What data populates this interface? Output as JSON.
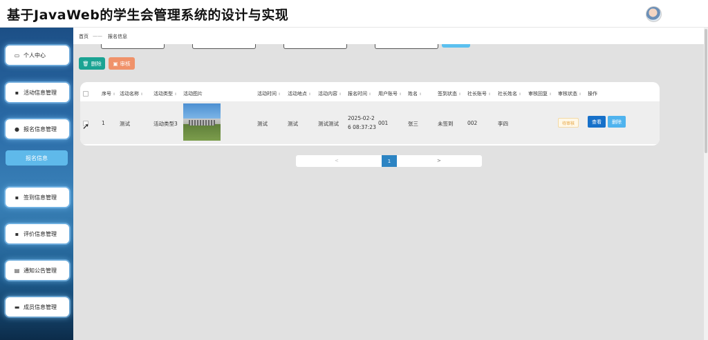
{
  "app": {
    "title": "基于JavaWeb的学生会管理系统的设计与实现"
  },
  "sidebar": {
    "items": [
      {
        "label": "个人中心",
        "icon": "calendar-icon"
      },
      {
        "label": "活动信息管理",
        "icon": "grid-icon"
      },
      {
        "label": "报名信息管理",
        "icon": "user-icon"
      },
      {
        "label": "签到信息管理",
        "icon": "grid-icon"
      },
      {
        "label": "评价信息管理",
        "icon": "grid-icon"
      },
      {
        "label": "通知公告管理",
        "icon": "clipboard-icon"
      },
      {
        "label": "成员信息管理",
        "icon": "briefcase-icon"
      }
    ],
    "sub_active": "报名信息"
  },
  "breadcrumb": {
    "home": "首页",
    "separator": "——",
    "current": "报名信息"
  },
  "toolbar": {
    "delete_label": "删除",
    "audit_label": "审核"
  },
  "table": {
    "headers": [
      "序号",
      "活动名称",
      "活动类型",
      "活动图片",
      "活动时间",
      "活动地点",
      "活动内容",
      "报名时间",
      "用户账号",
      "姓名",
      "签到状态",
      "社长账号",
      "社长姓名",
      "审核回复",
      "审核状态",
      "操作"
    ],
    "rows": [
      {
        "index": "1",
        "activity_name": "测试",
        "activity_type": "活动类型3",
        "activity_time": "测试",
        "location": "测试",
        "content": "测试测试",
        "signup_time_line1": "2025-02-2",
        "signup_time_line2": "6 08:37:23",
        "user_account": "001",
        "name": "张三",
        "checkin_status": "未签到",
        "leader_account": "002",
        "leader_name": "李四",
        "audit_reply": "",
        "audit_status": "待审核",
        "view_label": "查看",
        "delete_label": "删除"
      }
    ]
  },
  "pagination": {
    "prev": "<",
    "current": "1",
    "next": ">"
  },
  "colors": {
    "accent": "#2c84c3",
    "delete_button": "#1ba393",
    "audit_button": "#f0926a",
    "pending": "#e6a23c"
  }
}
